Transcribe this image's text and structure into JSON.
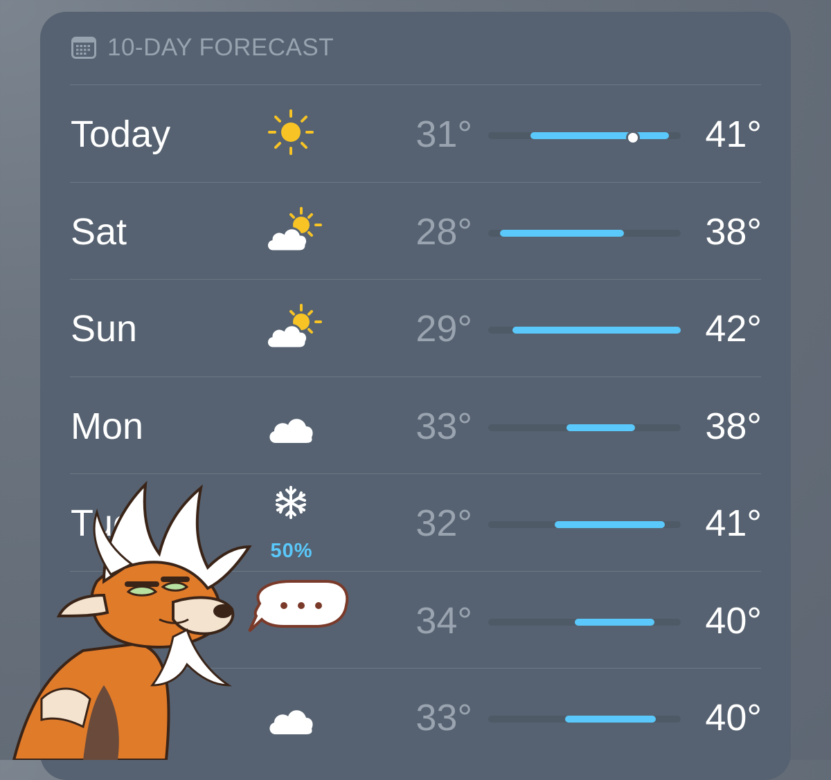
{
  "header": {
    "title": "10-DAY FORECAST",
    "icon": "calendar-icon"
  },
  "scale": {
    "min_temp": 27,
    "max_temp": 43
  },
  "colors": {
    "bar": "#5ac8fa",
    "track": "#4f5a67",
    "card": "#566271",
    "precip": "#5ac8fa"
  },
  "days": [
    {
      "label": "Today",
      "icon": "sun-icon",
      "precip": "",
      "low": "31°",
      "high": "41°",
      "low_val": 31,
      "high_val": 40,
      "bar_start": 30.5,
      "bar_end": 42,
      "current_val": 39
    },
    {
      "label": "Sat",
      "icon": "partly-sunny-icon",
      "precip": "",
      "low": "28°",
      "high": "38°",
      "low_val": 28,
      "high_val": 38,
      "bar_start": 28,
      "bar_end": 38.3
    },
    {
      "label": "Sun",
      "icon": "partly-sunny-icon",
      "precip": "",
      "low": "29°",
      "high": "42°",
      "low_val": 29,
      "high_val": 42,
      "bar_start": 29,
      "bar_end": 43
    },
    {
      "label": "Mon",
      "icon": "cloud-icon",
      "precip": "",
      "low": "33°",
      "high": "38°",
      "low_val": 33,
      "high_val": 38,
      "bar_start": 33.5,
      "bar_end": 39.2
    },
    {
      "label": "Tue",
      "icon": "snowflake-icon",
      "precip": "50%",
      "low": "32°",
      "high": "41°",
      "low_val": 32,
      "high_val": 41,
      "bar_start": 32.5,
      "bar_end": 41.7
    },
    {
      "label": "",
      "icon": "",
      "precip": "",
      "low": "34°",
      "high": "40°",
      "low_val": 34,
      "high_val": 40,
      "bar_start": 34.2,
      "bar_end": 40.8
    },
    {
      "label": "",
      "icon": "cloud-icon",
      "precip": "",
      "low": "33°",
      "high": "40°",
      "low_val": 33,
      "high_val": 40,
      "bar_start": 33.4,
      "bar_end": 40.9
    }
  ],
  "overlay": {
    "speech_bubble": "..."
  }
}
